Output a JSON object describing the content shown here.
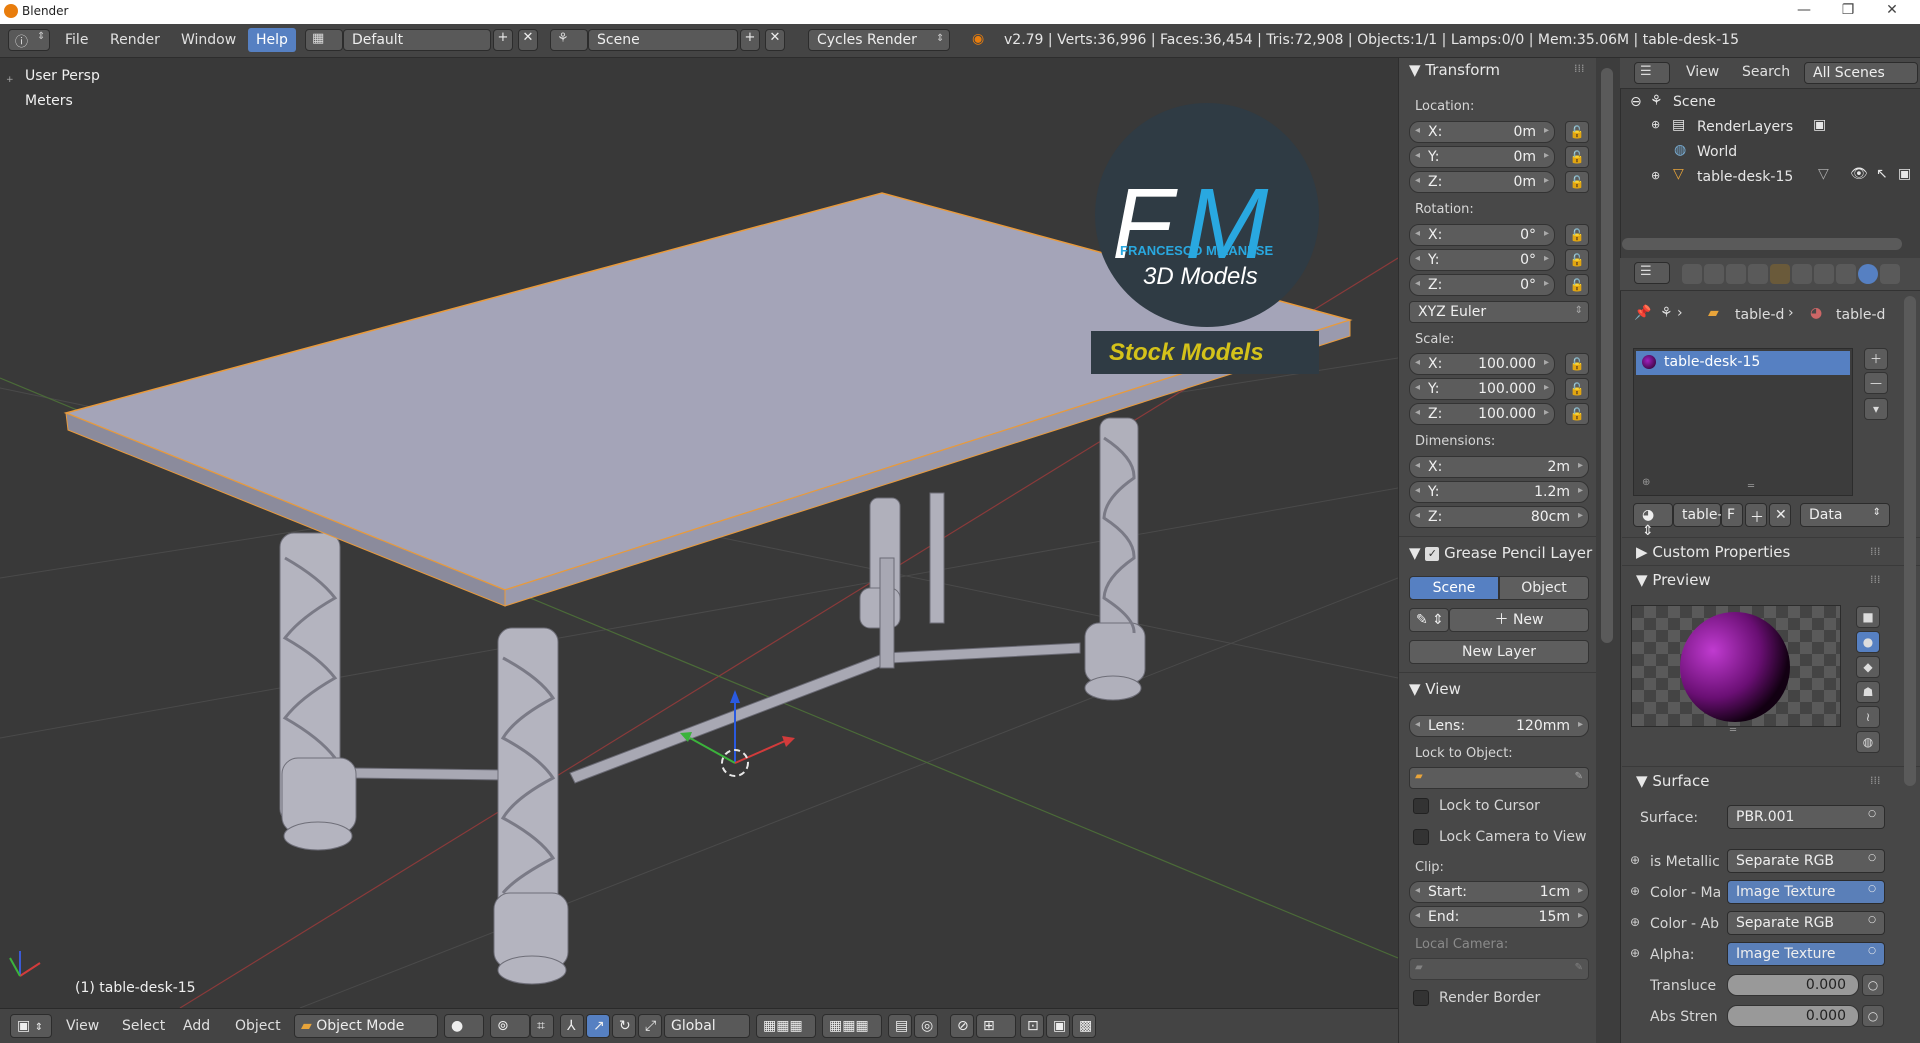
{
  "window": {
    "title": "Blender"
  },
  "infobar": {
    "menus": [
      "File",
      "Render",
      "Window",
      "Help"
    ],
    "layout": "Default",
    "scene": "Scene",
    "engine": "Cycles Render",
    "stats": "v2.79 | Verts:36,996 | Faces:36,454 | Tris:72,908 | Objects:1/1 | Lamps:0/0 | Mem:35.06M | table-desk-15"
  },
  "viewport": {
    "view_name": "User Persp",
    "units": "Meters",
    "object_label": "(1) table-desk-15",
    "watermark": {
      "initials_f": "F",
      "initials_m": "M",
      "brand": "FRANCESCO MILANESE",
      "subtitle": "3D Models",
      "banner": "Stock Models"
    }
  },
  "footer": {
    "menus": [
      "View",
      "Select",
      "Add",
      "Object"
    ],
    "mode": "Object Mode",
    "orientation": "Global"
  },
  "transform": {
    "title": "Transform",
    "location_label": "Location:",
    "location": [
      {
        "axis": "X:",
        "value": "0m"
      },
      {
        "axis": "Y:",
        "value": "0m"
      },
      {
        "axis": "Z:",
        "value": "0m"
      }
    ],
    "rotation_label": "Rotation:",
    "rotation": [
      {
        "axis": "X:",
        "value": "0°"
      },
      {
        "axis": "Y:",
        "value": "0°"
      },
      {
        "axis": "Z:",
        "value": "0°"
      }
    ],
    "rotation_mode": "XYZ Euler",
    "scale_label": "Scale:",
    "scale": [
      {
        "axis": "X:",
        "value": "100.000"
      },
      {
        "axis": "Y:",
        "value": "100.000"
      },
      {
        "axis": "Z:",
        "value": "100.000"
      }
    ],
    "dimensions_label": "Dimensions:",
    "dimensions": [
      {
        "axis": "X:",
        "value": "2m"
      },
      {
        "axis": "Y:",
        "value": "1.2m"
      },
      {
        "axis": "Z:",
        "value": "80cm"
      }
    ]
  },
  "grease_pencil": {
    "title": "Grease Pencil Layer",
    "tab_scene": "Scene",
    "tab_object": "Object",
    "new": "New",
    "new_layer": "New Layer"
  },
  "view": {
    "title": "View",
    "lens_label": "Lens:",
    "lens": "120mm",
    "lock_to_object": "Lock to Object:",
    "lock_to_cursor": "Lock to Cursor",
    "lock_camera": "Lock Camera to View",
    "clip_label": "Clip:",
    "clip_start_label": "Start:",
    "clip_start": "1cm",
    "clip_end_label": "End:",
    "clip_end": "15m",
    "local_camera": "Local Camera:",
    "render_border": "Render Border"
  },
  "outliner": {
    "menus": [
      "View",
      "Search"
    ],
    "filter": "All Scenes",
    "items": [
      "Scene",
      "RenderLayers",
      "World",
      "table-desk-15"
    ]
  },
  "properties": {
    "breadcrumb": [
      "table-d",
      "table-d"
    ],
    "material_slot": "table-desk-15",
    "material_name": "table-",
    "fake_user": "F",
    "link": "Data",
    "custom_properties": "Custom Properties",
    "preview": "Preview",
    "surface_title": "Surface",
    "surface_label": "Surface:",
    "surface_value": "PBR.001",
    "inputs": [
      {
        "label": "is Metallic",
        "value": "Separate RGB",
        "blue": false
      },
      {
        "label": "Color - Ma",
        "value": "Image Texture",
        "blue": true
      },
      {
        "label": "Color - Ab",
        "value": "Separate RGB",
        "blue": false
      },
      {
        "label": "Alpha:",
        "value": "Image Texture",
        "blue": true
      }
    ],
    "translucence_label": "Transluce",
    "translucence": "0.000",
    "abs_label": "Abs Stren",
    "abs": "0.000"
  },
  "colors": {
    "accent": "#5680c2",
    "viewport_bg": "#393939",
    "panel_bg": "#484848",
    "watermark_blue": "#29a8e0",
    "banner_text": "#d4c21a"
  }
}
